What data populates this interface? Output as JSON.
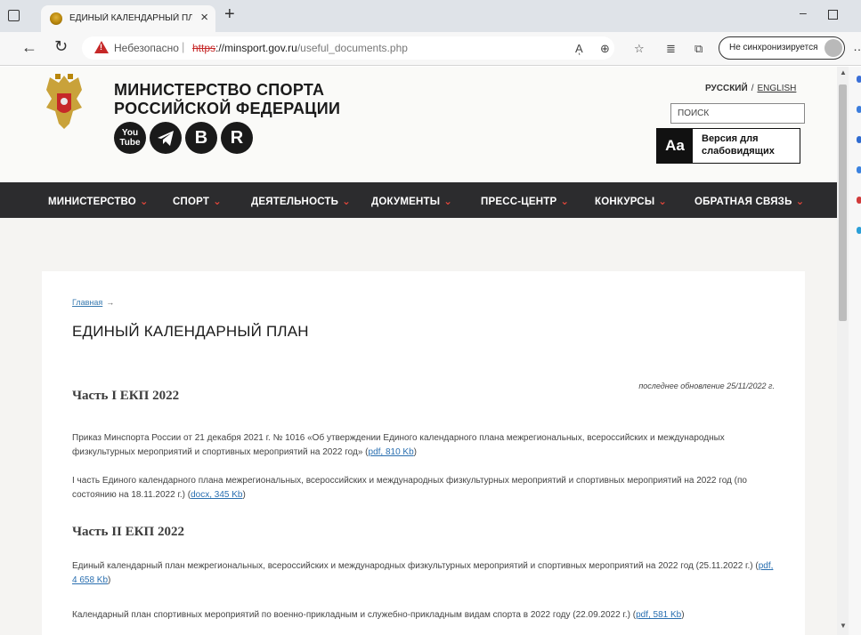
{
  "browser": {
    "tab": {
      "title": "ЕДИНЫЙ КАЛЕНДАРНЫЙ ПЛАН",
      "close": "×"
    },
    "new_tab": "+",
    "window": {
      "minimize": "–"
    },
    "address": {
      "security_label": "Небезопасно",
      "separator": "|",
      "url_scheme": "https",
      "url_host": "://minsport.gov.ru",
      "url_path": "/useful_documents.php"
    },
    "tools": {
      "read_aloud": "Aͅ",
      "zoom": "⊕",
      "favorite": "☆",
      "favorites": "≣",
      "collections": "⧉"
    },
    "sync_label": "Не синхронизируется",
    "more": "…"
  },
  "site": {
    "name_line1": "МИНИСТЕРСТВО СПОРТА",
    "name_line2": "РОССИЙСКОЙ ФЕДЕРАЦИИ",
    "social": {
      "youtube_top": "You",
      "youtube_bottom": "Tube",
      "vk": "B",
      "rutube": "R"
    },
    "lang_ru": "РУССКИЙ",
    "lang_sep": "/",
    "lang_en": "ENGLISH",
    "search_placeholder": "ПОИСК",
    "a11y_icon": "Aa",
    "a11y_label": "Версия для слабовидящих"
  },
  "nav": {
    "items": [
      {
        "label": "МИНИСТЕРСТВО",
        "caret": "⌄"
      },
      {
        "label": "СПОРТ",
        "caret": "⌄"
      },
      {
        "label": "ДЕЯТЕЛЬНОСТЬ",
        "caret": "⌄"
      },
      {
        "label": "ДОКУМЕНТЫ",
        "caret": "⌄"
      },
      {
        "label": "ПРЕСС-ЦЕНТР",
        "caret": "⌄"
      },
      {
        "label": "КОНКУРСЫ",
        "caret": "⌄"
      },
      {
        "label": "ОБРАТНАЯ СВЯЗЬ",
        "caret": "⌄"
      }
    ]
  },
  "content": {
    "breadcrumb_home": "Главная",
    "breadcrumb_arrow": "→",
    "title": "ЕДИНЫЙ КАЛЕНДАРНЫЙ ПЛАН",
    "updated": "последнее обновление 25/11/2022 г.",
    "section1_title": "Часть I ЕКП 2022",
    "p1_text": "Приказ Минспорта России от 21 декабря 2021 г. № 1016 «Об утверждении Единого календарного плана межрегиональных, всероссийских и международных физкультурных мероприятий и спортивных мероприятий на 2022 год» (",
    "p1_link": "pdf, 810 Kb",
    "p1_end": ")",
    "p2_text": "I часть Единого календарного плана межрегиональных, всероссийских и международных физкультурных мероприятий и спортивных мероприятий на 2022 год (по состоянию на 18.11.2022 г.) (",
    "p2_link": "docx, 345 Kb",
    "p2_end": ")",
    "section2_title": "Часть II ЕКП 2022",
    "p3_text": "Единый календарный план межрегиональных, всероссийских и международных физкультурных мероприятий и спортивных мероприятий на 2022 год (25.11.2022 г.)  (",
    "p3_link": "pdf, 4 658 Kb",
    "p3_end": ")",
    "p4_text": "Календарный план спортивных мероприятий по военно-прикладным и служебно-прикладным видам спорта в 2022 году (22.09.2022 г.) (",
    "p4_link": "pdf, 581 Kb",
    "p4_end": ")"
  },
  "scrollbar": {
    "up": "▲",
    "down": "▼"
  },
  "colors": {
    "nav_bg": "#2c2c2e",
    "nav_caret": "#e3463a",
    "link": "#2a6fb0",
    "insecure": "#c62828"
  }
}
